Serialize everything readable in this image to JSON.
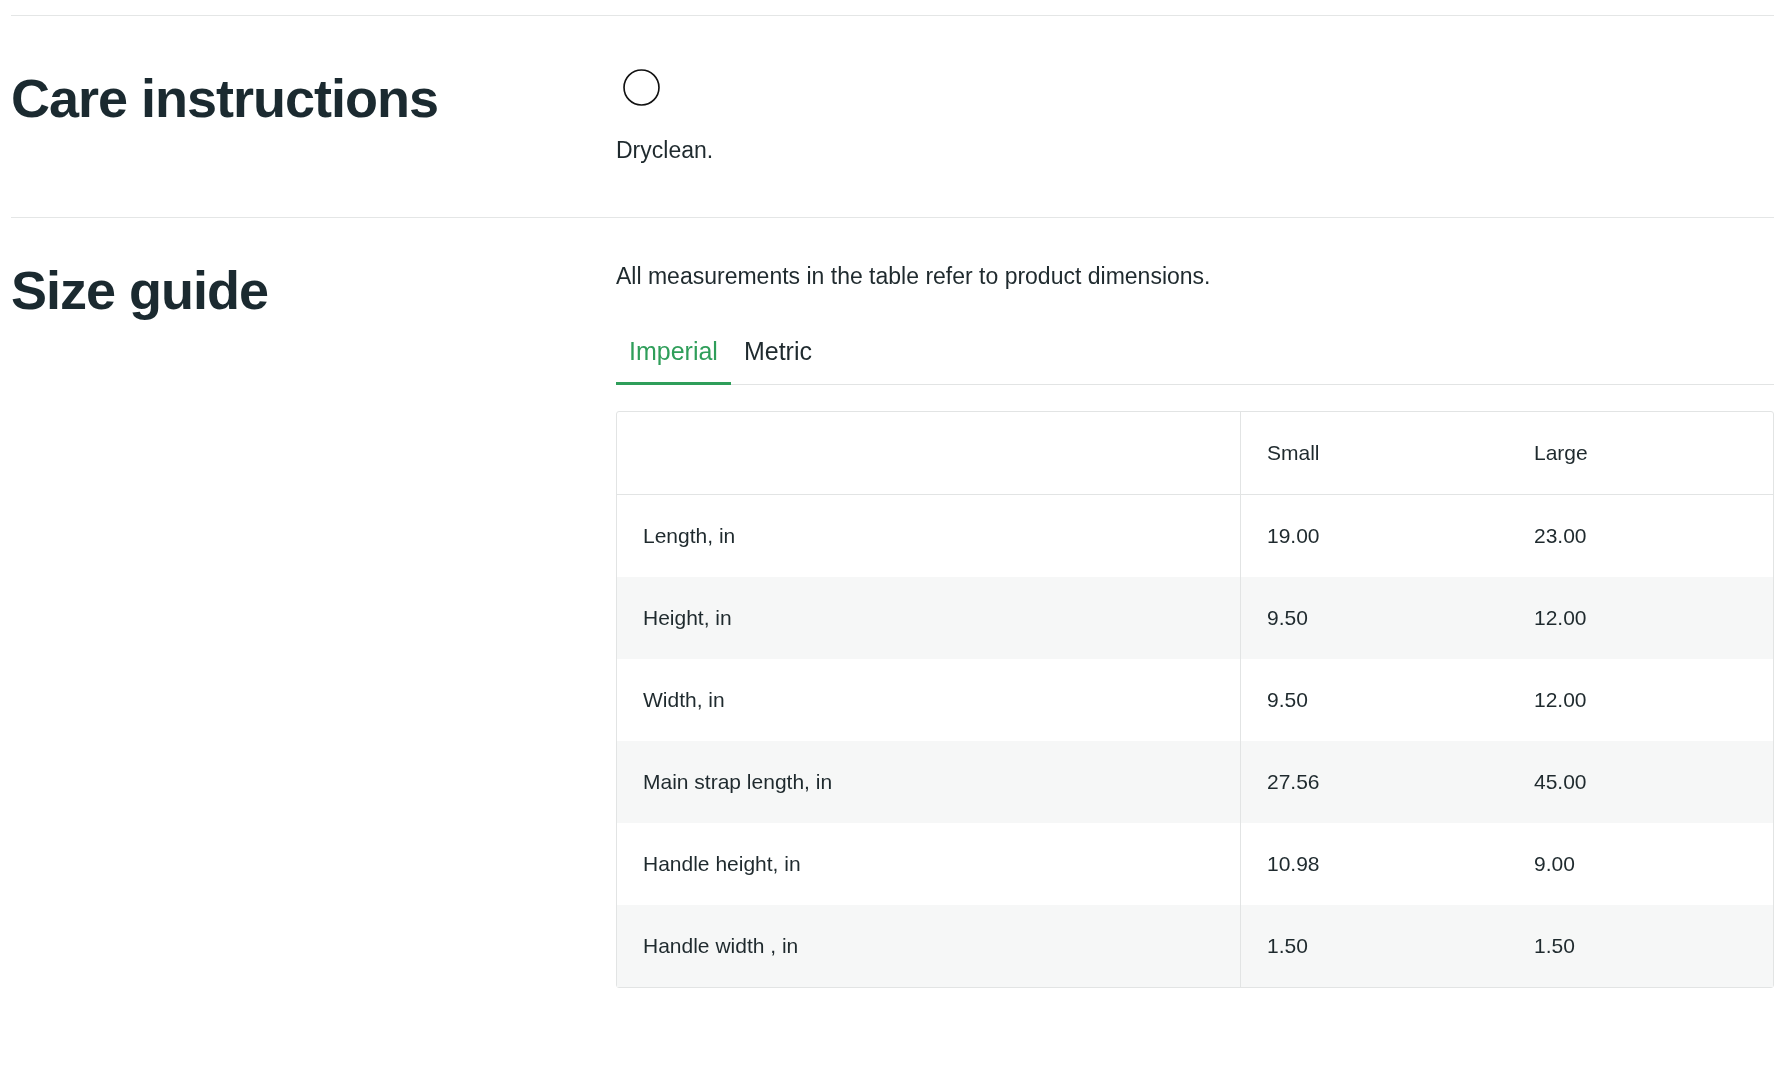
{
  "sections": [
    {
      "kind": "care",
      "title": "Care instructions",
      "text": "Dryclean."
    },
    {
      "kind": "size",
      "title": "Size guide",
      "intro": "All measurements in the table refer to product dimensions.",
      "tabs": [
        {
          "label": "Imperial",
          "selected": true
        },
        {
          "label": "Metric",
          "selected": false
        }
      ],
      "table": {
        "columns": [
          "Small",
          "Large"
        ],
        "rows": [
          {
            "label": "Length, in",
            "values": [
              "19.00",
              "23.00"
            ]
          },
          {
            "label": "Height, in",
            "values": [
              "9.50",
              "12.00"
            ]
          },
          {
            "label": "Width, in",
            "values": [
              "9.50",
              "12.00"
            ]
          },
          {
            "label": "Main strap length, in",
            "values": [
              "27.56",
              "45.00"
            ]
          },
          {
            "label": "Handle height, in",
            "values": [
              "10.98",
              "9.00"
            ]
          },
          {
            "label": "Handle width , in",
            "values": [
              "1.50",
              "1.50"
            ]
          }
        ]
      }
    }
  ]
}
